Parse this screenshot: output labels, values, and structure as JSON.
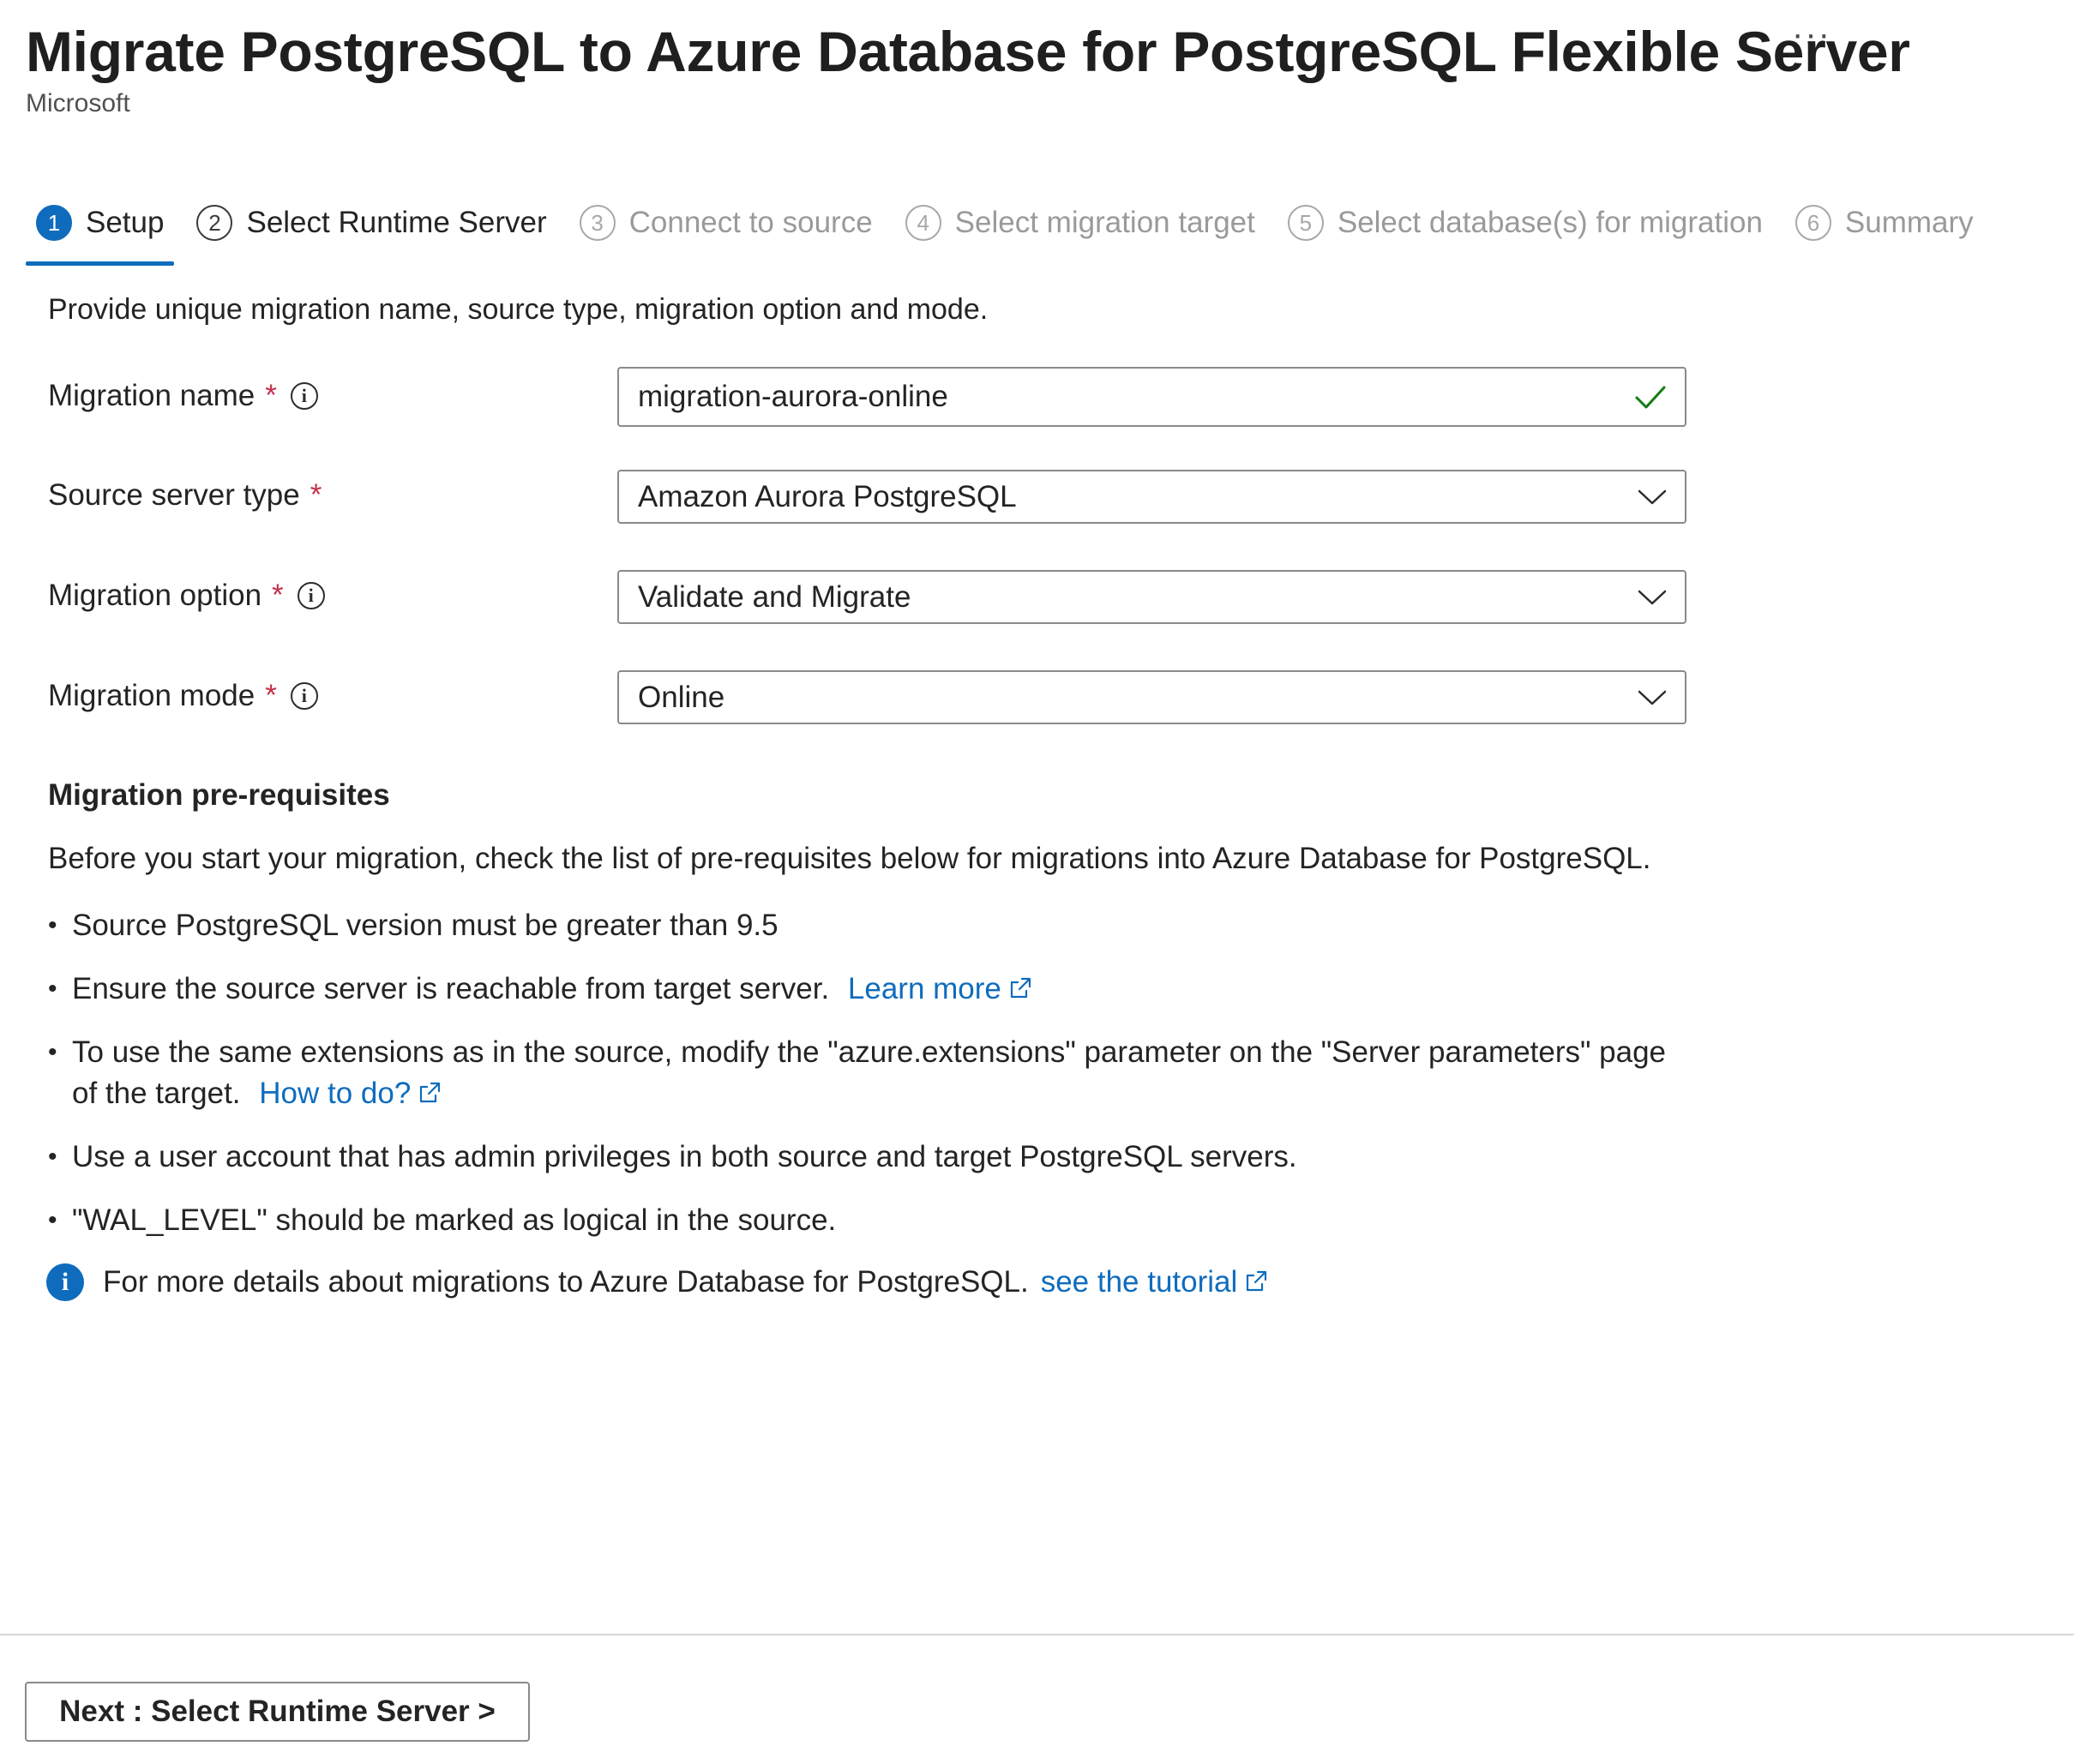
{
  "header": {
    "title": "Migrate PostgreSQL to Azure Database for PostgreSQL Flexible Server",
    "publisher": "Microsoft",
    "more_icon": "ellipsis-icon",
    "more_label": "···"
  },
  "tabs": [
    {
      "number": "1",
      "label": "Setup",
      "state": "active"
    },
    {
      "number": "2",
      "label": "Select Runtime Server",
      "state": "enabled"
    },
    {
      "number": "3",
      "label": "Connect to source",
      "state": "disabled"
    },
    {
      "number": "4",
      "label": "Select migration target",
      "state": "disabled"
    },
    {
      "number": "5",
      "label": "Select database(s) for migration",
      "state": "disabled"
    },
    {
      "number": "6",
      "label": "Summary",
      "state": "disabled"
    }
  ],
  "intro": "Provide unique migration name, source type, migration option and mode.",
  "form": {
    "migration_name": {
      "label": "Migration name",
      "required": "*",
      "value": "migration-aurora-online",
      "valid_icon": "checkmark-icon"
    },
    "source_server_type": {
      "label": "Source server type",
      "required": "*",
      "value": "Amazon Aurora PostgreSQL"
    },
    "migration_option": {
      "label": "Migration option",
      "required": "*",
      "value": "Validate and Migrate"
    },
    "migration_mode": {
      "label": "Migration mode",
      "required": "*",
      "value": "Online"
    }
  },
  "prereq": {
    "title": "Migration pre-requisites",
    "intro": "Before you start your migration, check the list of pre-requisites below for migrations into Azure Database for PostgreSQL.",
    "items": [
      {
        "text": "Source PostgreSQL version must be greater than 9.5"
      },
      {
        "text": "Ensure the source server is reachable from target server.",
        "link": "Learn more"
      },
      {
        "text": "To use the same extensions as in the source, modify the \"azure.extensions\" parameter on the \"Server parameters\" page of the target.",
        "link": "How to do?"
      },
      {
        "text": "Use a user account that has admin privileges in both source and target PostgreSQL servers."
      },
      {
        "text": "\"WAL_LEVEL\" should be marked as logical in the source."
      }
    ],
    "note_text": "For more details about migrations to Azure Database for PostgreSQL.",
    "note_link": "see the tutorial",
    "note_icon": "info-icon"
  },
  "footer": {
    "next_button": "Next : Select Runtime Server >"
  },
  "colors": {
    "accent": "#0f6cbd",
    "required": "#c4314b",
    "valid": "#107c10"
  }
}
